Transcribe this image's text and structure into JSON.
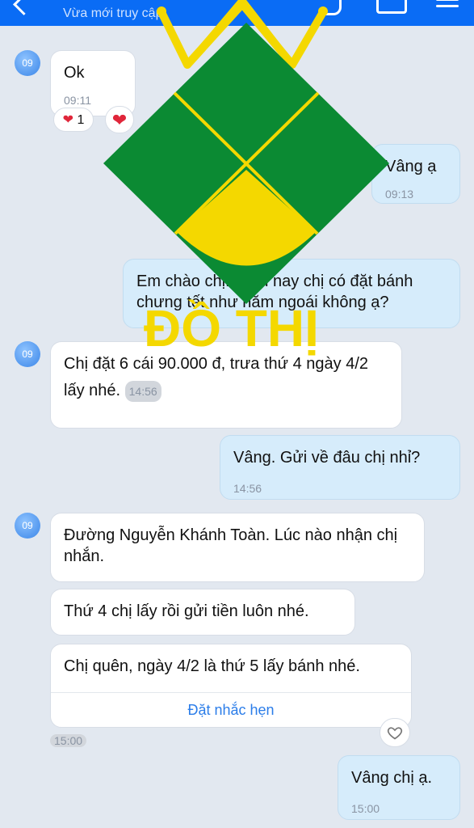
{
  "header": {
    "subtitle": "Vừa mới truy cập",
    "accent": "#0a6cf5"
  },
  "avatar_label": "09",
  "messages": [
    {
      "text": "Ok",
      "time": "09:11",
      "reaction_count": "1"
    },
    {
      "text": "Vâng ạ",
      "time": "09:13"
    },
    {
      "text": "Em chào chị. Năm nay chị có đặt bánh chưng tết như năm ngoái không ạ?"
    },
    {
      "text": "Chị đặt 6 cái 90.000 đ, trưa thứ 4 ngày 4/2 lấy nhé.",
      "time": "14:56"
    },
    {
      "text": "Vâng. Gửi về  đâu chị nhỉ?",
      "time": "14:56"
    },
    {
      "text": "Đường Nguyễn Khánh Toàn. Lúc nào nhận chị nhắn."
    },
    {
      "text": "Thứ 4 chị lấy rồi gửi tiền luôn nhé."
    },
    {
      "text": "Chị quên, ngày 4/2 là thứ 5 lấy bánh nhé.",
      "action": "Đặt nhắc hẹn"
    },
    {
      "time": "15:00"
    },
    {
      "text": "Vâng chị ạ.",
      "time": "15:00"
    }
  ],
  "watermark": {
    "text": "ĐỒ THỊ",
    "colors": {
      "green": "#0b8a33",
      "yellow": "#f4d800"
    }
  }
}
